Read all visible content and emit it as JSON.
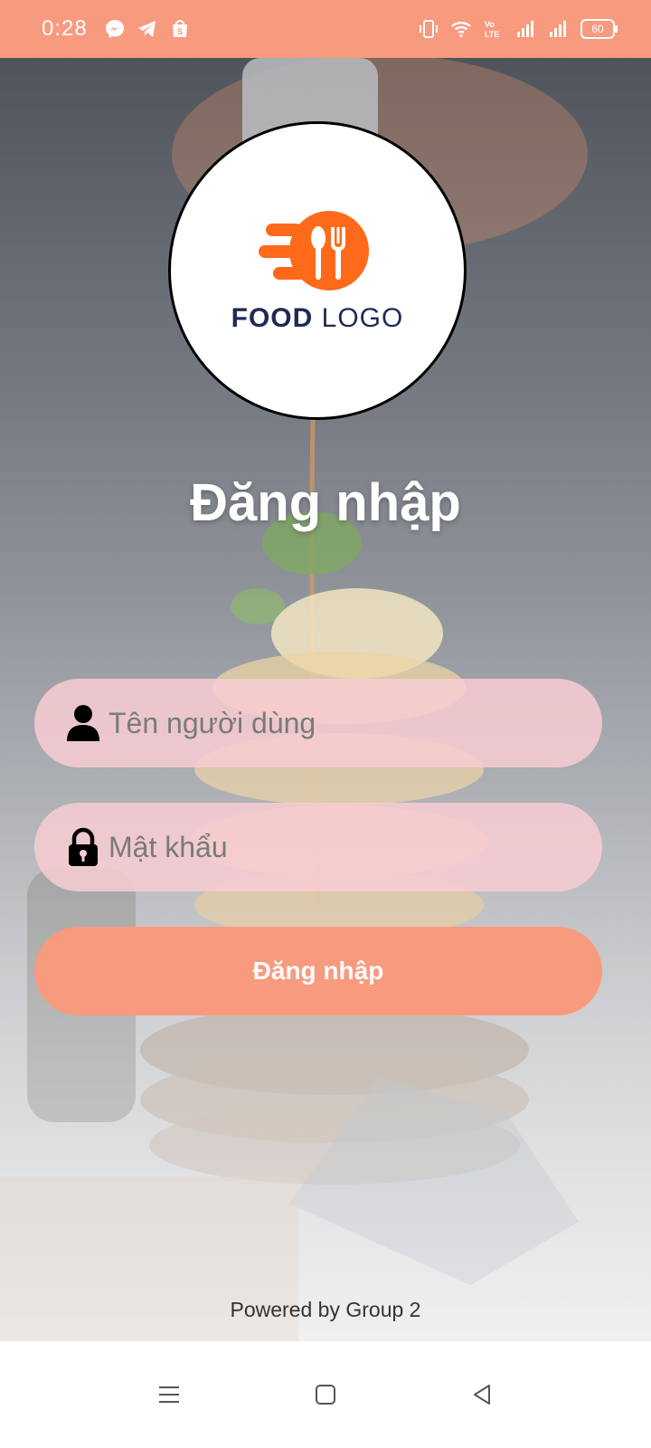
{
  "status_bar": {
    "time": "0:28",
    "battery": "60",
    "left_icons": [
      "messenger-icon",
      "telegram-icon",
      "shopee-icon"
    ],
    "right_icons": [
      "vibrate-icon",
      "wifi-icon",
      "volte-icon",
      "signal-icon",
      "signal-icon"
    ]
  },
  "logo": {
    "text_bold": "FOOD",
    "text_light": "LOGO",
    "accent": "#FF6A1A",
    "text_color": "#1E2A55"
  },
  "login": {
    "title": "Đăng nhập",
    "username_placeholder": "Tên người dùng",
    "password_placeholder": "Mật khẩu",
    "button_label": "Đăng nhập"
  },
  "footer": {
    "text": "Powered by Group 2"
  },
  "colors": {
    "primary": "#F89A7E",
    "field_bg": "#F8CDD2"
  },
  "nav_bar": {
    "buttons": [
      "menu-icon",
      "home-icon",
      "back-icon"
    ]
  }
}
